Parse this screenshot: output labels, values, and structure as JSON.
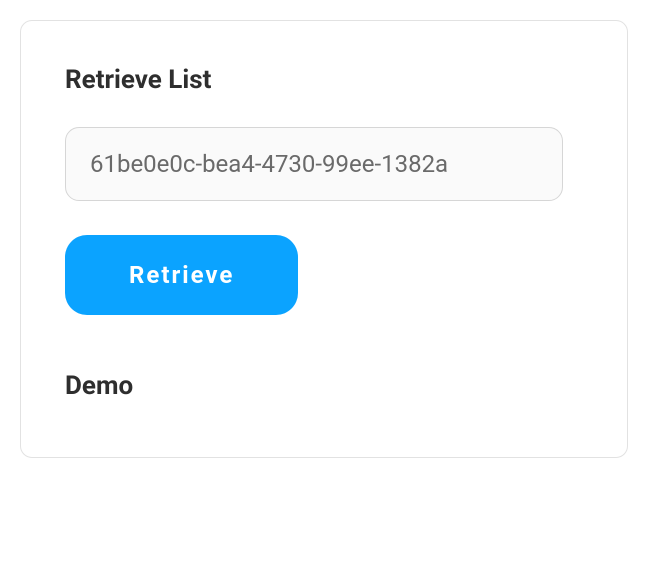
{
  "card": {
    "title": "Retrieve List",
    "input_value": "61be0e0c-bea4-4730-99ee-1382a",
    "input_placeholder": "",
    "button_label": "Retrieve",
    "demo_title": "Demo"
  }
}
